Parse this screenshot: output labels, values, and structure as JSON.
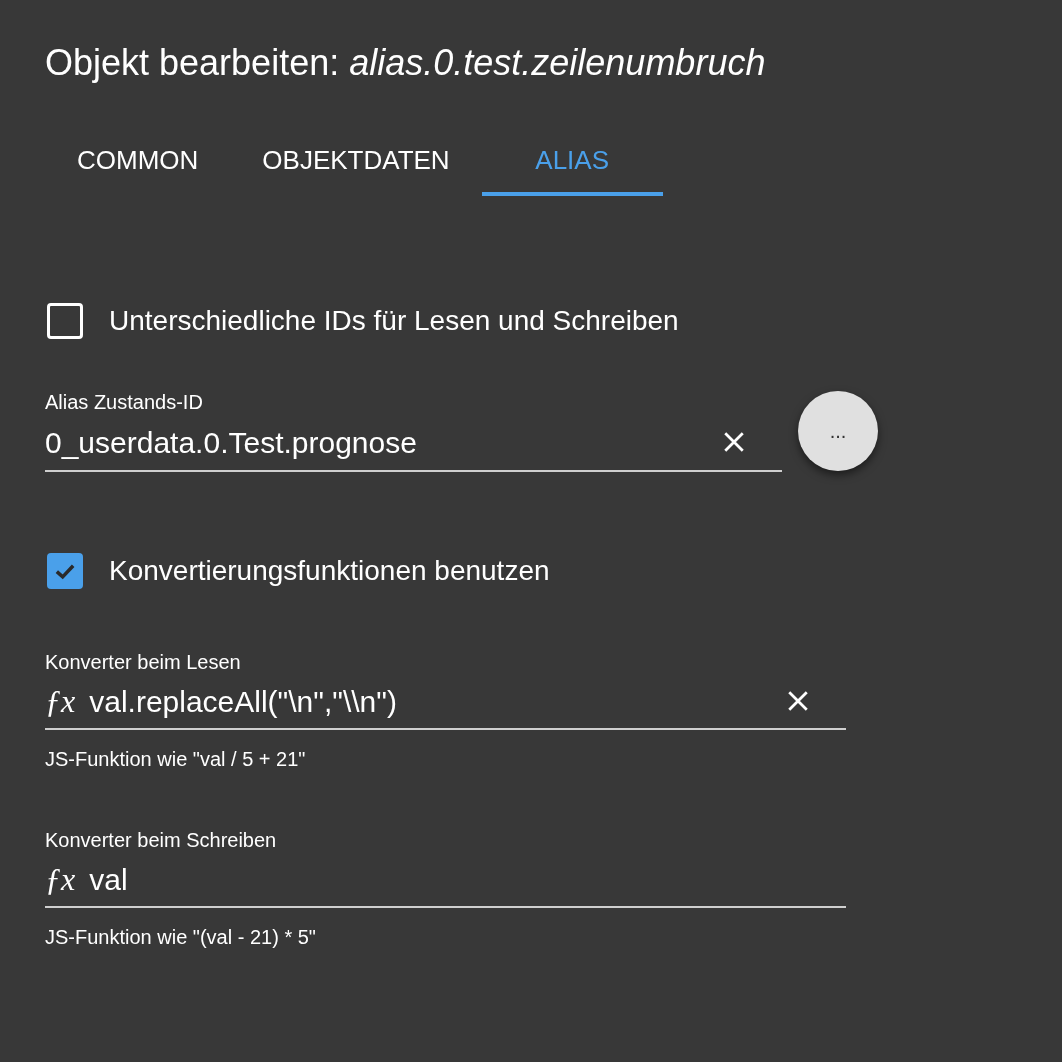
{
  "dialog": {
    "title_prefix": "Objekt bearbeiten: ",
    "title_object": "alias.0.test.zeilenumbruch"
  },
  "tabs": [
    {
      "label": "COMMON",
      "selected": false
    },
    {
      "label": "OBJEKTDATEN",
      "selected": false
    },
    {
      "label": "ALIAS",
      "selected": true
    }
  ],
  "separate_ids": {
    "label": "Unterschiedliche IDs für Lesen und Schreiben",
    "checked": false
  },
  "alias_id": {
    "label": "Alias Zustands-ID",
    "value": "0_userdata.0.Test.prognose",
    "clear": true,
    "browse_button": "..."
  },
  "use_converters": {
    "label": "Konvertierungsfunktionen benutzen",
    "checked": true
  },
  "converters": [
    {
      "label": "Konverter beim Lesen",
      "icon": "ƒx",
      "value": "val.replaceAll(\"\\n\",\"\\\\n\")",
      "clear": true,
      "helper": "JS-Funktion wie \"val / 5 + 21\""
    },
    {
      "label": "Konverter beim Schreiben",
      "icon": "ƒx",
      "value": "val",
      "clear": false,
      "helper": "JS-Funktion wie \"(val - 21) * 5\""
    }
  ]
}
